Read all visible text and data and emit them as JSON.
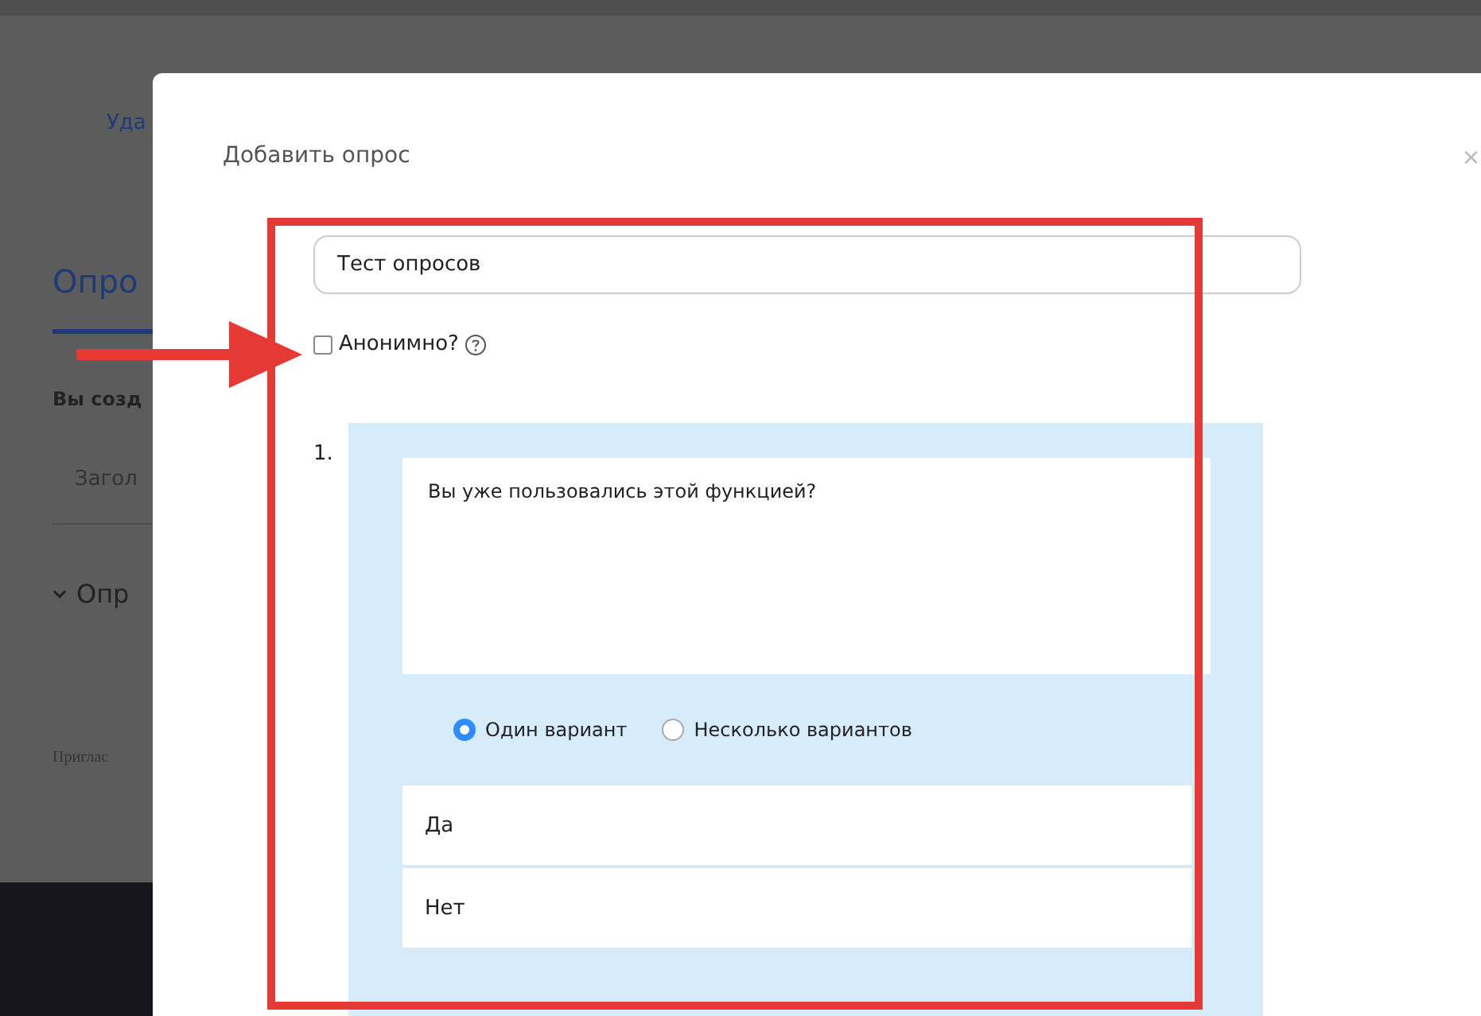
{
  "background": {
    "link": "Уда",
    "tab": "Опро",
    "heading": "Вы созд",
    "row": "Загол",
    "section": {
      "label": "Опр",
      "expanded": true
    },
    "footer_note": "Приглас"
  },
  "dialog": {
    "title": "Добавить опрос",
    "close": "×",
    "poll_title": "Тест опросов",
    "anonymous": {
      "label": "Анонимно?",
      "checked": false
    },
    "questions": [
      {
        "number": "1.",
        "text": "Вы уже пользовались этой функцией?",
        "types": [
          {
            "label": "Один вариант",
            "selected": true
          },
          {
            "label": "Несколько вариантов",
            "selected": false
          }
        ],
        "answers": [
          "Да",
          "Нет"
        ]
      }
    ]
  }
}
